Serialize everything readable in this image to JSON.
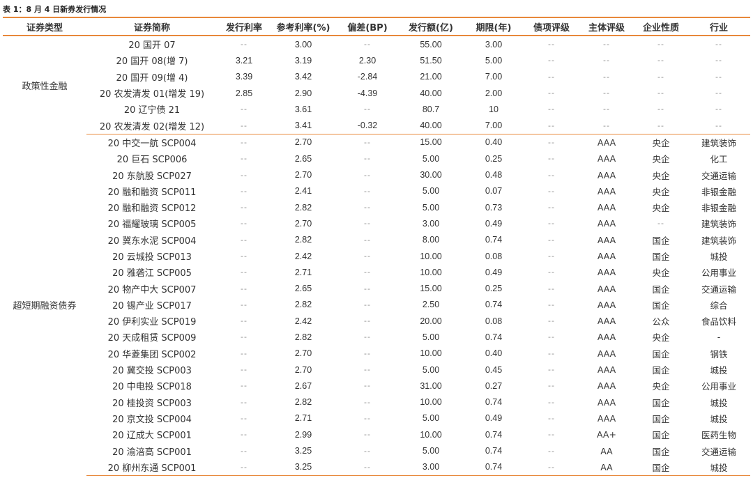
{
  "caption": "表 1：8 月 4 日新券发行情况",
  "headers": [
    "证券类型",
    "证券简称",
    "发行利率",
    "参考利率(%)",
    "偏差(BP)",
    "发行额(亿)",
    "期限(年)",
    "债项评级",
    "主体评级",
    "企业性质",
    "行业"
  ],
  "groups": [
    {
      "type": "政策性金融",
      "rows": [
        [
          "20 国开 07",
          "--",
          "3.00",
          "--",
          "55.00",
          "3.00",
          "--",
          "--",
          "--",
          "--"
        ],
        [
          "20 国开 08(增 7)",
          "3.21",
          "3.19",
          "2.30",
          "51.50",
          "5.00",
          "--",
          "--",
          "--",
          "--"
        ],
        [
          "20 国开 09(增 4)",
          "3.39",
          "3.42",
          "-2.84",
          "21.00",
          "7.00",
          "--",
          "--",
          "--",
          "--"
        ],
        [
          "20 农发清发 01(增发 19)",
          "2.85",
          "2.90",
          "-4.39",
          "40.00",
          "2.00",
          "--",
          "--",
          "--",
          "--"
        ],
        [
          "20 辽宁债 21",
          "--",
          "3.61",
          "--",
          "80.7",
          "10",
          "--",
          "--",
          "--",
          "--"
        ],
        [
          "20 农发清发 02(增发 12)",
          "--",
          "3.41",
          "-0.32",
          "40.00",
          "7.00",
          "--",
          "--",
          "--",
          "--"
        ]
      ]
    },
    {
      "type": "超短期融资债券",
      "rows": [
        [
          "20 中交一航 SCP004",
          "--",
          "2.70",
          "--",
          "15.00",
          "0.40",
          "--",
          "AAA",
          "央企",
          "建筑装饰"
        ],
        [
          "20 巨石 SCP006",
          "--",
          "2.65",
          "--",
          "5.00",
          "0.25",
          "--",
          "AAA",
          "央企",
          "化工"
        ],
        [
          "20 东航股 SCP027",
          "--",
          "2.70",
          "--",
          "30.00",
          "0.48",
          "--",
          "AAA",
          "央企",
          "交通运输"
        ],
        [
          "20 融和融资 SCP011",
          "--",
          "2.41",
          "--",
          "5.00",
          "0.07",
          "--",
          "AAA",
          "央企",
          "非银金融"
        ],
        [
          "20 融和融资 SCP012",
          "--",
          "2.82",
          "--",
          "5.00",
          "0.73",
          "--",
          "AAA",
          "央企",
          "非银金融"
        ],
        [
          "20 福耀玻璃 SCP005",
          "--",
          "2.70",
          "--",
          "3.00",
          "0.49",
          "--",
          "AAA",
          "--",
          "建筑装饰"
        ],
        [
          "20 冀东水泥 SCP004",
          "--",
          "2.82",
          "--",
          "8.00",
          "0.74",
          "--",
          "AAA",
          "国企",
          "建筑装饰"
        ],
        [
          "20 云城投 SCP013",
          "--",
          "2.42",
          "--",
          "10.00",
          "0.08",
          "--",
          "AAA",
          "国企",
          "城投"
        ],
        [
          "20 雅砻江 SCP005",
          "--",
          "2.71",
          "--",
          "10.00",
          "0.49",
          "--",
          "AAA",
          "央企",
          "公用事业"
        ],
        [
          "20 物产中大 SCP007",
          "--",
          "2.65",
          "--",
          "15.00",
          "0.25",
          "--",
          "AAA",
          "国企",
          "交通运输"
        ],
        [
          "20 锡产业 SCP017",
          "--",
          "2.82",
          "--",
          "2.50",
          "0.74",
          "--",
          "AAA",
          "国企",
          "综合"
        ],
        [
          "20 伊利实业 SCP019",
          "--",
          "2.42",
          "--",
          "20.00",
          "0.08",
          "--",
          "AAA",
          "公众",
          "食品饮料"
        ],
        [
          "20 天成租赁 SCP009",
          "--",
          "2.82",
          "--",
          "5.00",
          "0.74",
          "--",
          "AAA",
          "央企",
          "-"
        ],
        [
          "20 华菱集团 SCP002",
          "--",
          "2.70",
          "--",
          "10.00",
          "0.40",
          "--",
          "AAA",
          "国企",
          "钢铁"
        ],
        [
          "20 冀交投 SCP003",
          "--",
          "2.70",
          "--",
          "5.00",
          "0.45",
          "--",
          "AAA",
          "国企",
          "城投"
        ],
        [
          "20 中电投 SCP018",
          "--",
          "2.67",
          "--",
          "31.00",
          "0.27",
          "--",
          "AAA",
          "央企",
          "公用事业"
        ],
        [
          "20 桂投资 SCP003",
          "--",
          "2.82",
          "--",
          "10.00",
          "0.74",
          "--",
          "AAA",
          "国企",
          "城投"
        ],
        [
          "20 京文投 SCP004",
          "--",
          "2.71",
          "--",
          "5.00",
          "0.49",
          "--",
          "AAA",
          "国企",
          "城投"
        ],
        [
          "20 辽成大 SCP001",
          "--",
          "2.99",
          "--",
          "10.00",
          "0.74",
          "--",
          "AA+",
          "国企",
          "医药生物"
        ],
        [
          "20 渝涪高 SCP001",
          "--",
          "3.25",
          "--",
          "5.00",
          "0.74",
          "--",
          "AA",
          "国企",
          "交通运输"
        ],
        [
          "20 柳州东通 SCP001",
          "--",
          "3.25",
          "--",
          "3.00",
          "0.74",
          "--",
          "AA",
          "国企",
          "城投"
        ]
      ]
    }
  ]
}
